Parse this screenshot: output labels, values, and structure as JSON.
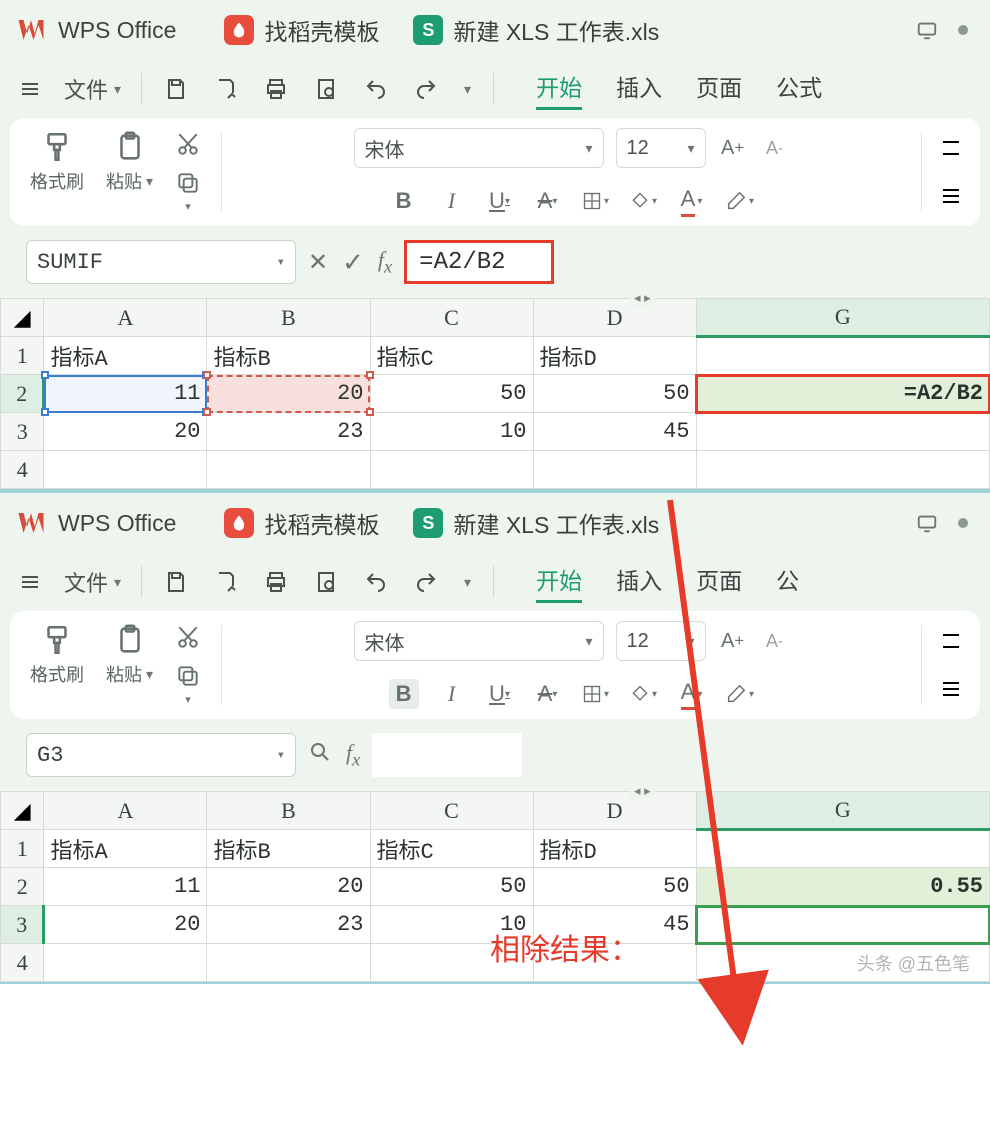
{
  "common": {
    "app_name": "WPS Office",
    "template_tab": "找稻壳模板",
    "doc_tab": "新建 XLS 工作表.xls",
    "doc_icon_letter": "S",
    "file_menu": "文件",
    "menu_tabs": {
      "start": "开始",
      "insert": "插入",
      "page": "页面",
      "formula": "公式",
      "formula_short": "公"
    },
    "ribbon": {
      "format_painter": "格式刷",
      "paste": "粘贴",
      "font_name": "宋体",
      "font_size": "12",
      "font_inc": "A⁺",
      "font_dec": "A⁻"
    }
  },
  "top": {
    "namebox": "SUMIF",
    "formula": "=A2/B2",
    "columns": [
      "A",
      "B",
      "C",
      "D",
      "G"
    ],
    "headers": [
      "指标A",
      "指标B",
      "指标C",
      "指标D"
    ],
    "row2": {
      "a": "11",
      "b": "20",
      "c": "50",
      "d": "50",
      "g": "=A2/B2"
    },
    "row3": {
      "a": "20",
      "b": "23",
      "c": "10",
      "d": "45"
    }
  },
  "bottom": {
    "namebox": "G3",
    "columns": [
      "A",
      "B",
      "C",
      "D",
      "G"
    ],
    "headers": [
      "指标A",
      "指标B",
      "指标C",
      "指标D"
    ],
    "row2": {
      "a": "11",
      "b": "20",
      "c": "50",
      "d": "50",
      "g": "0.55"
    },
    "row3": {
      "a": "20",
      "b": "23",
      "c": "10",
      "d": "45"
    }
  },
  "annotation": "相除结果：",
  "watermark": "头条 @五色笔"
}
